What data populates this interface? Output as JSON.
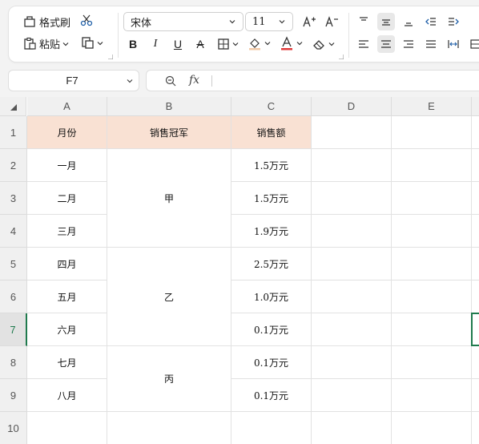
{
  "ribbon": {
    "format_painter_label": "格式刷",
    "paste_label": "粘贴",
    "font_name": "宋体",
    "font_size": "11"
  },
  "formula_bar": {
    "cell_ref": "F7",
    "fx_label": "fx",
    "formula_value": ""
  },
  "columns": [
    "A",
    "B",
    "C",
    "D",
    "E"
  ],
  "rows": [
    "1",
    "2",
    "3",
    "4",
    "5",
    "6",
    "7",
    "8",
    "9",
    "10"
  ],
  "selected_cell": "F7",
  "colors": {
    "header_fill": "#f9e1d3",
    "selection": "#1f7a4d",
    "font_color_bar": "#e03a3a"
  },
  "table": {
    "headers": [
      "月份",
      "销售冠军",
      "销售额"
    ],
    "months": [
      "一月",
      "二月",
      "三月",
      "四月",
      "五月",
      "六月",
      "七月",
      "八月"
    ],
    "champions": [
      {
        "name": "甲",
        "rows": [
          2,
          4
        ]
      },
      {
        "name": "乙",
        "rows": [
          5,
          7
        ]
      },
      {
        "name": "丙",
        "rows": [
          8,
          9
        ]
      }
    ],
    "sales": [
      "1.5万元",
      "1.5万元",
      "1.9万元",
      "2.5万元",
      "1.0万元",
      "0.1万元",
      "0.1万元",
      "0.1万元"
    ]
  }
}
